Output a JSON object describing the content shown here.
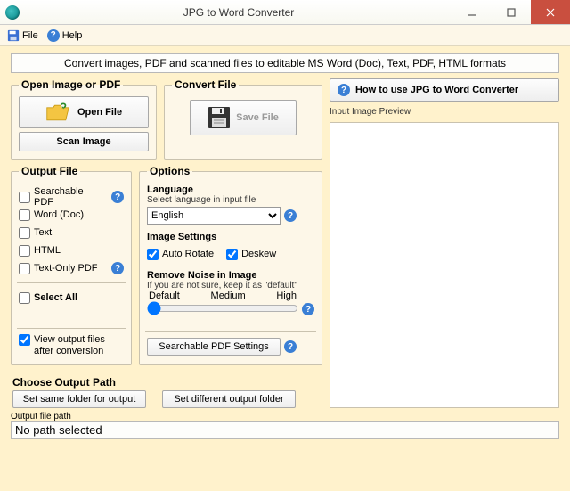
{
  "window": {
    "title": "JPG to Word Converter"
  },
  "menu": {
    "file": "File",
    "help": "Help"
  },
  "banner": "Convert images, PDF and scanned files to editable MS Word (Doc), Text, PDF, HTML formats",
  "open": {
    "legend": "Open Image or PDF",
    "openfile": "Open File",
    "scan": "Scan Image"
  },
  "convert": {
    "legend": "Convert File",
    "save": "Save File"
  },
  "how": "How to use JPG to Word Converter",
  "preview_label": "Input Image Preview",
  "output": {
    "legend": "Output File",
    "items": [
      "Searchable PDF",
      "Word (Doc)",
      "Text",
      "HTML",
      "Text-Only PDF"
    ],
    "selectall": "Select All",
    "view": "View output files after conversion"
  },
  "options": {
    "legend": "Options",
    "language": {
      "heading": "Language",
      "sub": "Select language in input file",
      "value": "English"
    },
    "imgsettings": {
      "heading": "Image Settings",
      "auto": "Auto Rotate",
      "deskew": "Deskew"
    },
    "noise": {
      "heading": "Remove Noise in Image",
      "sub": "If you are not sure, keep it as \"default\"",
      "labels": [
        "Default",
        "Medium",
        "High"
      ]
    },
    "searchable": "Searchable PDF Settings"
  },
  "choose": {
    "legend": "Choose Output Path",
    "same": "Set same folder for output",
    "diff": "Set different output folder"
  },
  "path": {
    "label": "Output file path",
    "value": "No path selected"
  }
}
